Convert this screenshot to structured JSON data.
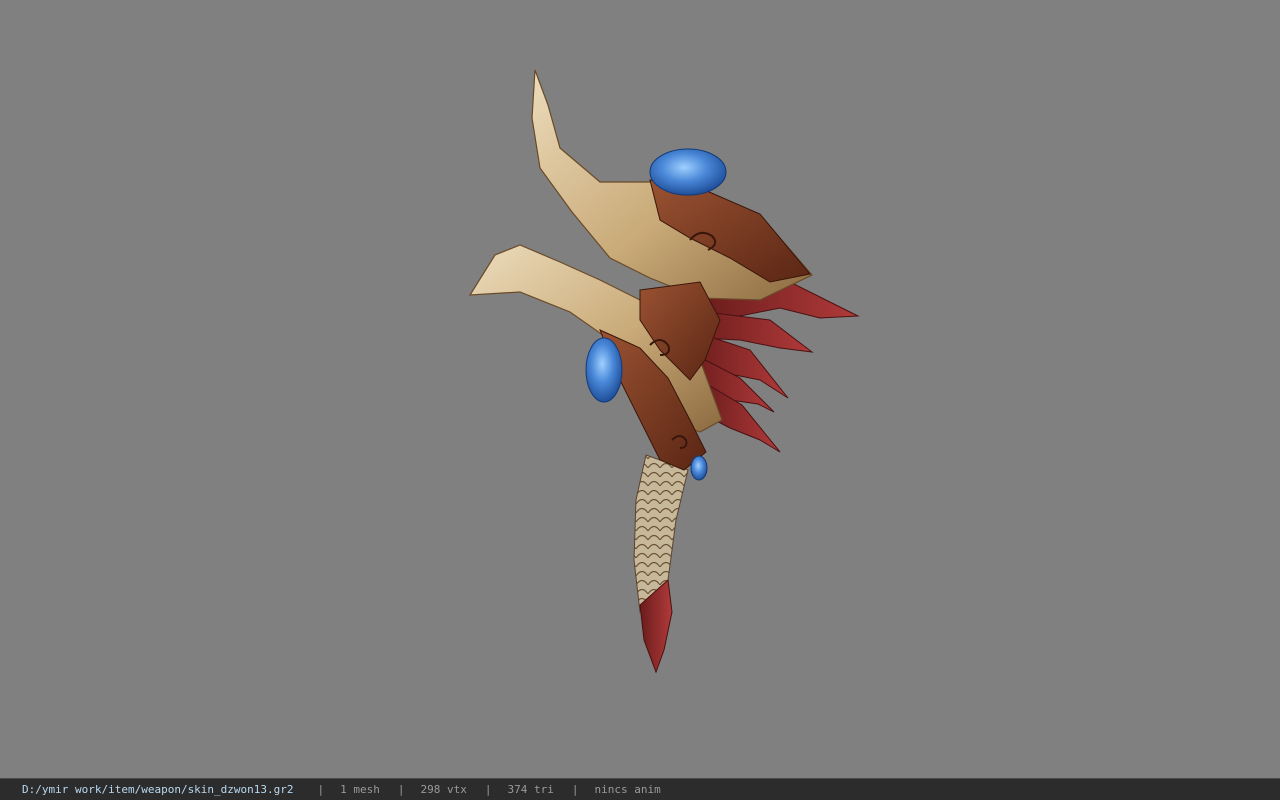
{
  "viewport": {
    "model_description_icon": "weapon-model"
  },
  "statusbar": {
    "file_path": "D:/ymir work/item/weapon/skin_dzwon13.gr2",
    "separator": "|",
    "mesh_count": "1 mesh",
    "vertex_count": "298 vtx",
    "triangle_count": "374 tri",
    "anim_status": "nincs anim"
  },
  "colors": {
    "background": "#808080",
    "statusbar_bg": "#2c2c2c",
    "path_text": "#b8d8f0",
    "stat_text": "#9a9a9a",
    "gem": "#3f7fd0",
    "bone": "#d9c29a",
    "wood": "#7a3a22",
    "blade_red": "#8f2a2a"
  }
}
